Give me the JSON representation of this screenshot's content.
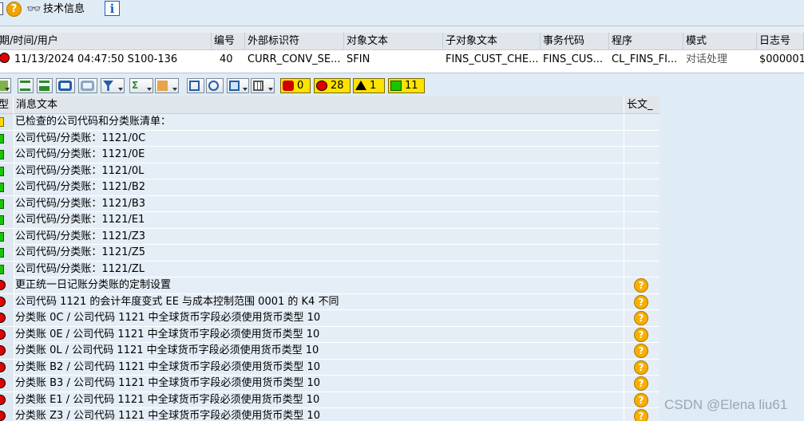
{
  "toolbar": {
    "tech_info_label": "技术信息",
    "icons": [
      "document-icon",
      "help-icon",
      "glasses-icon",
      "info-icon"
    ]
  },
  "header": {
    "columns": [
      "期/时间/用户",
      "编号",
      "外部标识符",
      "对象文本",
      "子对象文本",
      "事务代码",
      "程序",
      "模式",
      "日志号"
    ],
    "row": {
      "status": "red",
      "datetime_user": "11/13/2024  04:47:50  S100-136",
      "number": "40",
      "external_id": "CURR_CONV_SE...",
      "object_text": "SFIN",
      "subobject_text": "FINS_CUST_CHE...",
      "tcode": "FINS_CUS...",
      "program": "CL_FINS_FI...",
      "mode": "对话处理",
      "log_number": "$000001"
    }
  },
  "toolbar2": {
    "counts": {
      "stop": "0",
      "error": "28",
      "warning": "1",
      "success": "11"
    }
  },
  "grid": {
    "col_type": "型",
    "col_message": "消息文本",
    "col_longtext": "长文_",
    "rows": [
      {
        "type": "yellow",
        "text": "已检查的公司代码和分类账清单：",
        "help": false
      },
      {
        "type": "green",
        "text": "公司代码/分类账：1121/0C",
        "help": false
      },
      {
        "type": "green",
        "text": "公司代码/分类账：1121/0E",
        "help": false
      },
      {
        "type": "green",
        "text": "公司代码/分类账：1121/0L",
        "help": false
      },
      {
        "type": "green",
        "text": "公司代码/分类账：1121/B2",
        "help": false
      },
      {
        "type": "green",
        "text": "公司代码/分类账：1121/B3",
        "help": false
      },
      {
        "type": "green",
        "text": "公司代码/分类账：1121/E1",
        "help": false
      },
      {
        "type": "green",
        "text": "公司代码/分类账：1121/Z3",
        "help": false
      },
      {
        "type": "green",
        "text": "公司代码/分类账：1121/Z5",
        "help": false
      },
      {
        "type": "green",
        "text": "公司代码/分类账：1121/ZL",
        "help": false
      },
      {
        "type": "red",
        "text": "更正统一日记账分类账的定制设置",
        "help": true
      },
      {
        "type": "red",
        "text": "公司代码 1121 的会计年度变式 EE 与成本控制范围 0001 的 K4 不同",
        "help": true
      },
      {
        "type": "red",
        "text": "分类账 0C / 公司代码 1121 中全球货币字段必须使用货币类型 10",
        "help": true
      },
      {
        "type": "red",
        "text": "分类账 0E / 公司代码 1121 中全球货币字段必须使用货币类型 10",
        "help": true
      },
      {
        "type": "red",
        "text": "分类账 0L / 公司代码 1121 中全球货币字段必须使用货币类型 10",
        "help": true
      },
      {
        "type": "red",
        "text": "分类账 B2 / 公司代码 1121 中全球货币字段必须使用货币类型 10",
        "help": true
      },
      {
        "type": "red",
        "text": "分类账 B3 / 公司代码 1121 中全球货币字段必须使用货币类型 10",
        "help": true
      },
      {
        "type": "red",
        "text": "分类账 E1 / 公司代码 1121 中全球货币字段必须使用货币类型 10",
        "help": true
      },
      {
        "type": "red",
        "text": "分类账 Z3 / 公司代码 1121 中全球货币字段必须使用货币类型 10",
        "help": true
      }
    ]
  },
  "watermark": "CSDN @Elena liu61",
  "colors": {
    "error": "#e00000",
    "success": "#19c400",
    "warning": "#ffd800",
    "counter_bg": "#ffe300",
    "help": "#f5b000"
  }
}
